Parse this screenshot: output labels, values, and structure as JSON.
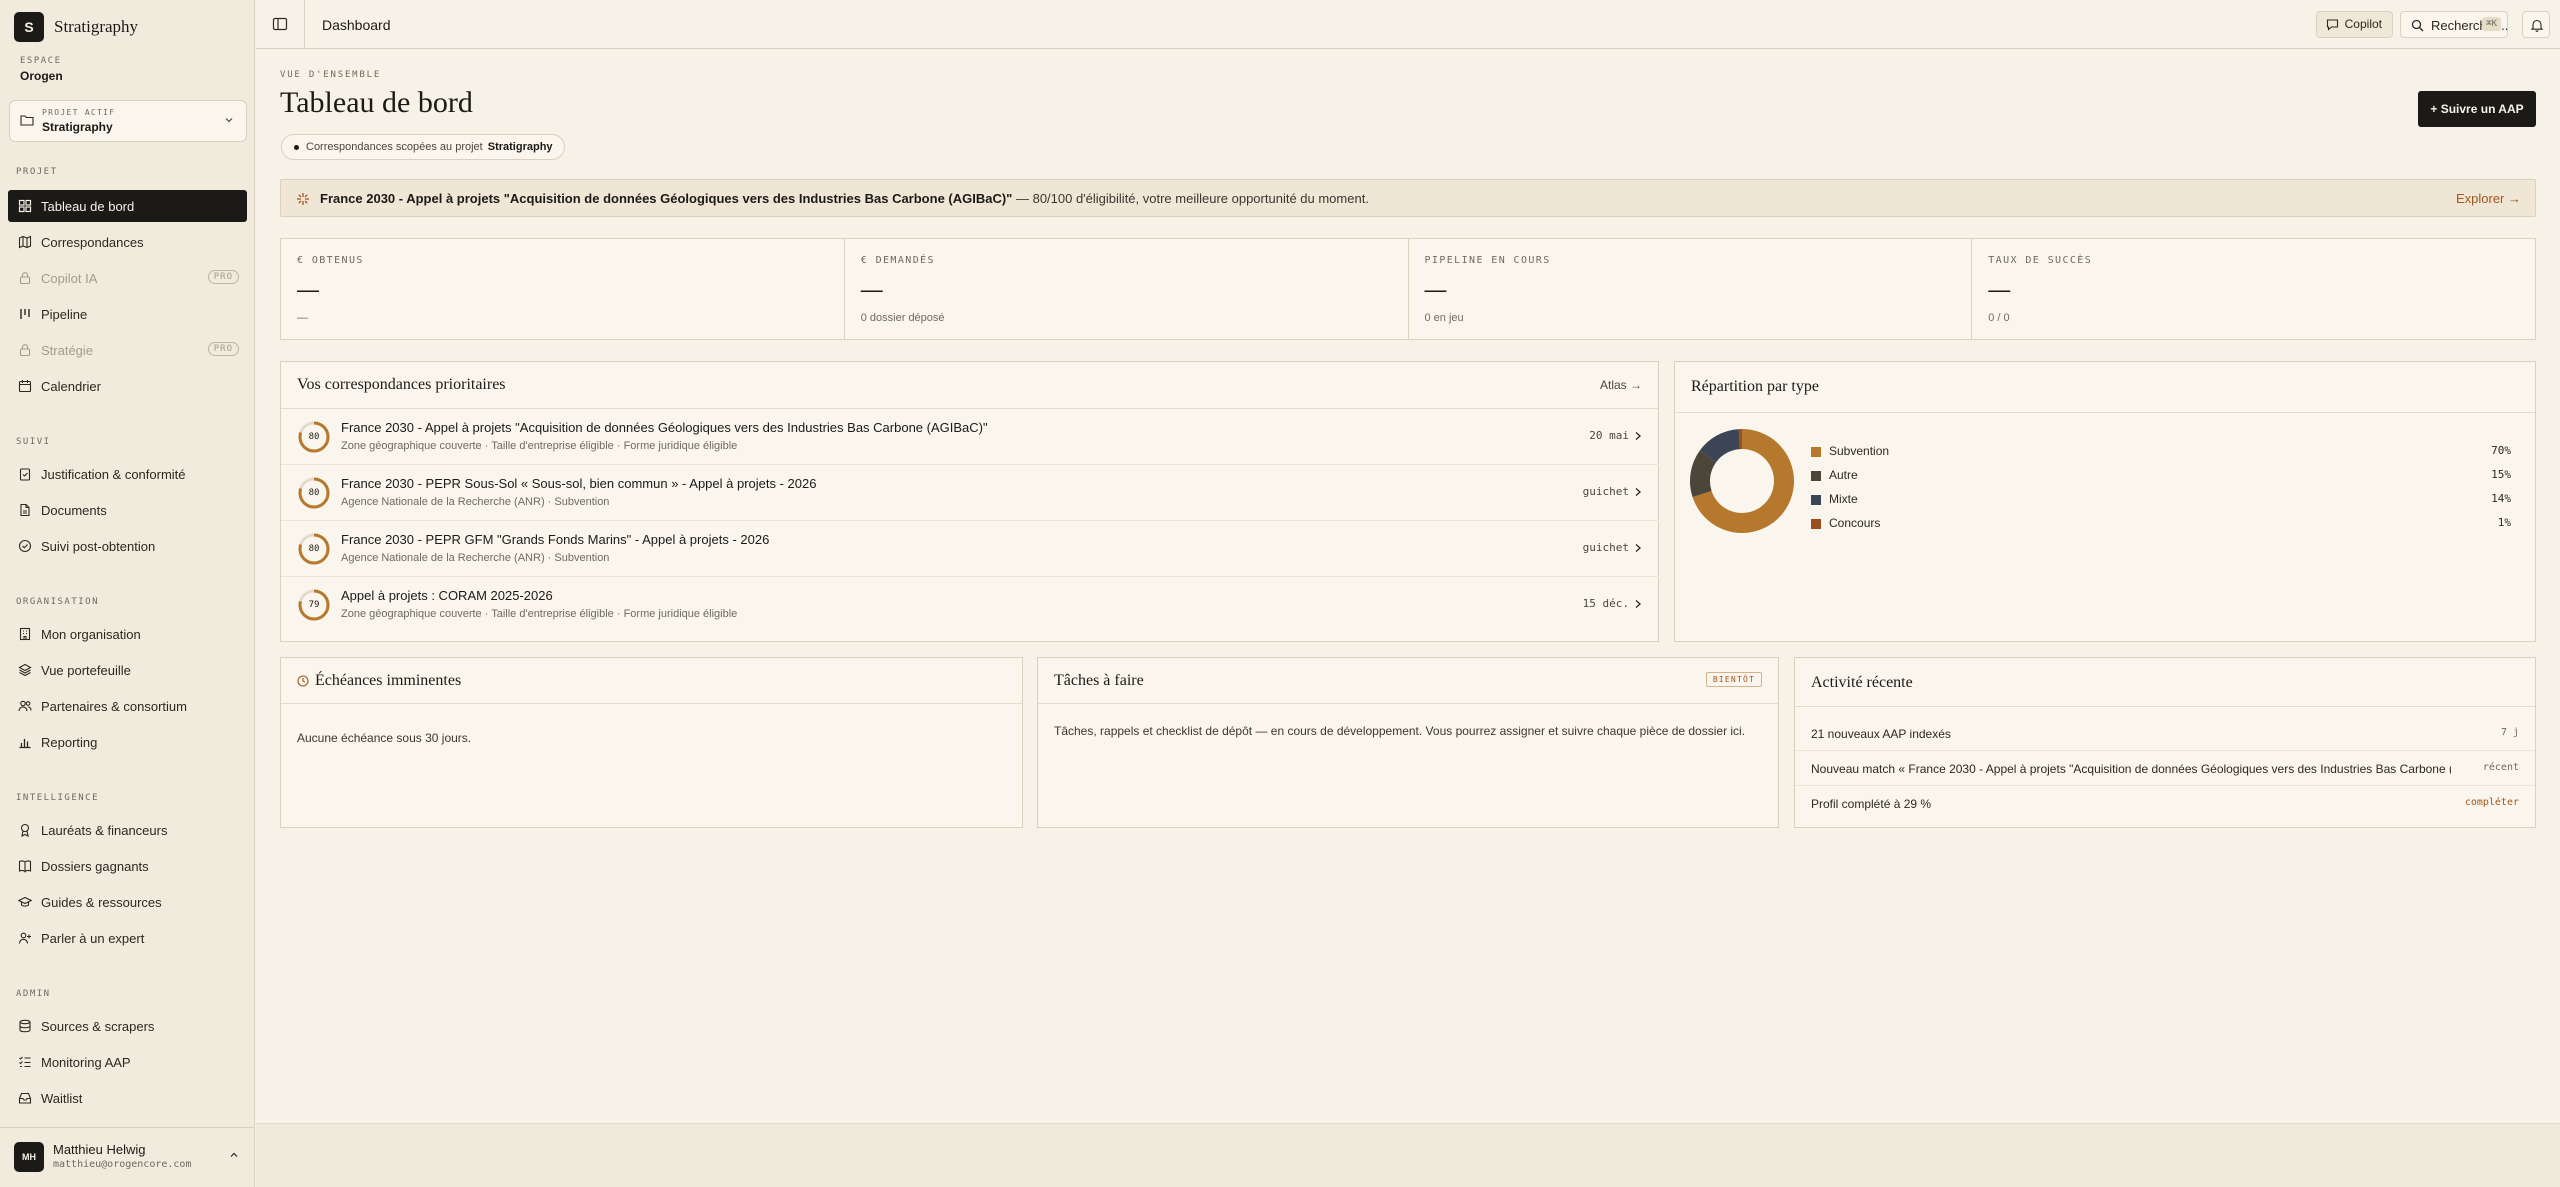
{
  "brand": {
    "logo_letter": "S",
    "name": "Stratigraphy"
  },
  "workspace": {
    "label": "ESPACE",
    "name": "Orogen"
  },
  "project": {
    "label": "PROJET ACTIF",
    "name": "Stratigraphy"
  },
  "nav": {
    "projet": {
      "label": "PROJET",
      "items": [
        {
          "label": "Tableau de bord",
          "icon": "grid-icon",
          "active": true
        },
        {
          "label": "Correspondances",
          "icon": "map-icon"
        },
        {
          "label": "Copilot IA",
          "icon": "lock-icon",
          "disabled": true,
          "badge": "PRO"
        },
        {
          "label": "Pipeline",
          "icon": "columns-icon"
        },
        {
          "label": "Stratégie",
          "icon": "lock-icon",
          "disabled": true,
          "badge": "PRO"
        },
        {
          "label": "Calendrier",
          "icon": "calendar-icon"
        }
      ]
    },
    "suivi": {
      "label": "SUIVI",
      "items": [
        {
          "label": "Justification & conformité",
          "icon": "clipboard-check-icon"
        },
        {
          "label": "Documents",
          "icon": "file-icon"
        },
        {
          "label": "Suivi post-obtention",
          "icon": "check-circle-icon"
        }
      ]
    },
    "organisation": {
      "label": "ORGANISATION",
      "items": [
        {
          "label": "Mon organisation",
          "icon": "building-icon"
        },
        {
          "label": "Vue portefeuille",
          "icon": "layers-icon"
        },
        {
          "label": "Partenaires & consortium",
          "icon": "users-icon"
        },
        {
          "label": "Reporting",
          "icon": "bar-chart-icon"
        }
      ]
    },
    "intelligence": {
      "label": "INTELLIGENCE",
      "items": [
        {
          "label": "Lauréats & financeurs",
          "icon": "award-icon"
        },
        {
          "label": "Dossiers gagnants",
          "icon": "book-icon"
        },
        {
          "label": "Guides & ressources",
          "icon": "graduation-cap-icon"
        },
        {
          "label": "Parler à un expert",
          "icon": "user-plus-icon"
        }
      ]
    },
    "admin": {
      "label": "ADMIN",
      "items": [
        {
          "label": "Sources & scrapers",
          "icon": "database-icon"
        },
        {
          "label": "Monitoring AAP",
          "icon": "list-check-icon"
        },
        {
          "label": "Waitlist",
          "icon": "inbox-icon"
        }
      ]
    }
  },
  "user": {
    "initials": "MH",
    "name": "Matthieu Helwig",
    "email": "matthieu@orogencore.com"
  },
  "topbar": {
    "breadcrumb": "Dashboard",
    "copilot_label": "Copilot",
    "search_label": "Rechercher...",
    "search_shortcut": "⌘K"
  },
  "header": {
    "overline": "VUE D'ENSEMBLE",
    "title": "Tableau de bord",
    "scope_text": "Correspondances scopées au projet",
    "scope_project": "Stratigraphy",
    "primary_action": "+ Suivre un AAP"
  },
  "banner": {
    "highlight": "France 2030 - Appel à projets \"Acquisition de données Géologiques vers des Industries Bas Carbone (AGIBaC)\"",
    "text": " — 80/100 d'éligibilité, votre meilleure opportunité du moment.",
    "link": "Explorer →"
  },
  "kpis": [
    {
      "label": "€ OBTENUS",
      "value": "—",
      "sub": "—"
    },
    {
      "label": "€ DEMANDÉS",
      "value": "—",
      "sub": "0 dossier déposé"
    },
    {
      "label": "PIPELINE EN COURS",
      "value": "—",
      "sub": "0 en jeu"
    },
    {
      "label": "TAUX DE SUCCÈS",
      "value": "—",
      "sub": "0 / 0"
    }
  ],
  "matches": {
    "title": "Vos correspondances prioritaires",
    "link": "Atlas →",
    "rows": [
      {
        "score": 80,
        "score_label": "80",
        "title": "France 2030 - Appel à projets \"Acquisition de données Géologiques vers des Industries Bas Carbone (AGIBaC)\"",
        "sub": "Zone géographique couverte · Taille d'entreprise éligible · Forme juridique éligible",
        "date": "20 mai"
      },
      {
        "score": 80,
        "score_label": "80",
        "title": "France 2030 - PEPR Sous-Sol « Sous-sol, bien commun » - Appel à projets - 2026",
        "sub": "Agence Nationale de la Recherche (ANR) · Subvention",
        "date": "guichet"
      },
      {
        "score": 80,
        "score_label": "80",
        "title": "France 2030 - PEPR GFM \"Grands Fonds Marins\" - Appel à projets - 2026",
        "sub": "Agence Nationale de la Recherche (ANR) · Subvention",
        "date": "guichet"
      },
      {
        "score": 79,
        "score_label": "79",
        "title": "Appel à projets : CORAM 2025-2026",
        "sub": "Zone géographique couverte · Taille d'entreprise éligible · Forme juridique éligible",
        "date": "15 déc."
      }
    ]
  },
  "chart_data": {
    "type": "pie",
    "title": "Répartition par type",
    "categories": [
      "Subvention",
      "Autre",
      "Mixte",
      "Concours"
    ],
    "values": [
      70,
      15,
      14,
      1
    ],
    "value_labels": [
      "70%",
      "15%",
      "14%",
      "1%"
    ],
    "colors": [
      "#b5782c",
      "#4b453a",
      "#3b4556",
      "#9c4f1e"
    ],
    "donut": true,
    "legend": "right"
  },
  "deadlines": {
    "title": "Échéances imminentes",
    "empty": "Aucune échéance sous 30 jours."
  },
  "tasks": {
    "title": "Tâches à faire",
    "badge": "BIENTÔT",
    "text": "Tâches, rappels et checklist de dépôt — en cours de développement. Vous pourrez assigner et suivre chaque pièce de dossier ici."
  },
  "activity": {
    "title": "Activité récente",
    "rows": [
      {
        "text": "21 nouveaux AAP indexés",
        "meta": "7 j"
      },
      {
        "text": "Nouveau match « France 2030 - Appel à projets \"Acquisition de données Géologiques vers des Industries Bas Carbone (…",
        "meta": "récent"
      },
      {
        "text": "Profil complété à 29 %",
        "meta": "compléter"
      }
    ]
  },
  "colors": {
    "accent": "#b5782c",
    "ink": "#1c1a16",
    "paper": "#faf6ee",
    "background": "#f7f2e8",
    "link": "#a3561a"
  }
}
